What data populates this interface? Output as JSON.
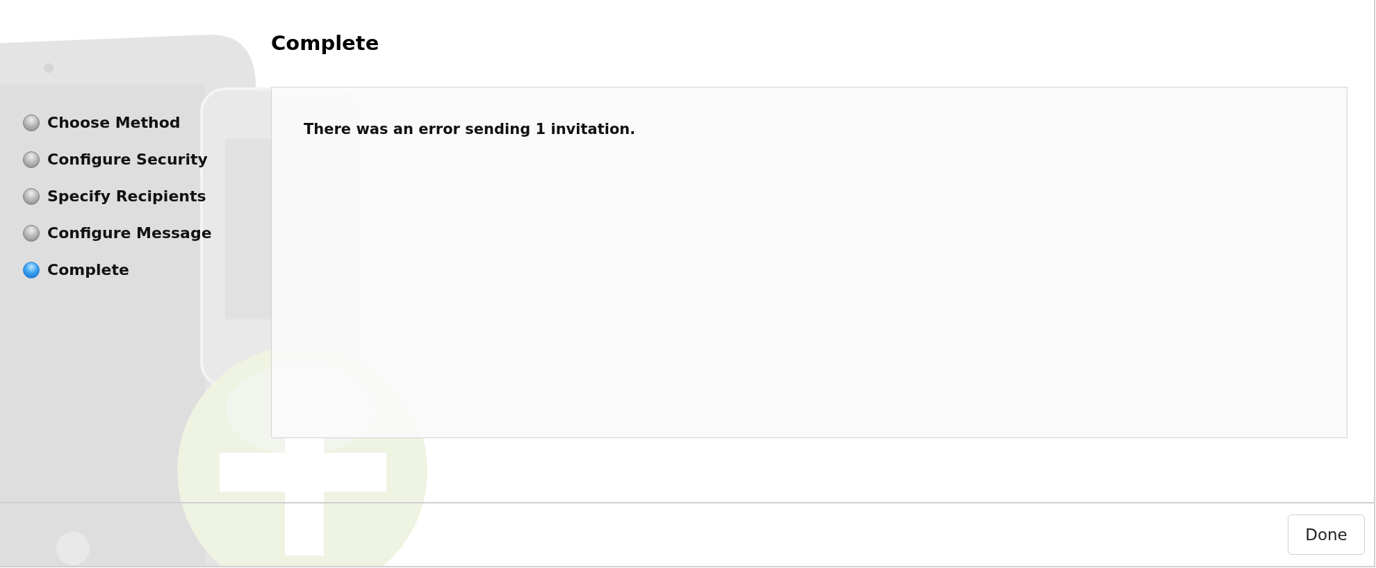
{
  "steps": [
    {
      "label": "Choose Method",
      "selected": false
    },
    {
      "label": "Configure Security",
      "selected": false
    },
    {
      "label": "Specify Recipients",
      "selected": false
    },
    {
      "label": "Configure Message",
      "selected": false
    },
    {
      "label": "Complete",
      "selected": true
    }
  ],
  "page_title": "Complete",
  "message": "There was an error sending 1 invitation.",
  "buttons": [
    {
      "label": "Done"
    }
  ]
}
